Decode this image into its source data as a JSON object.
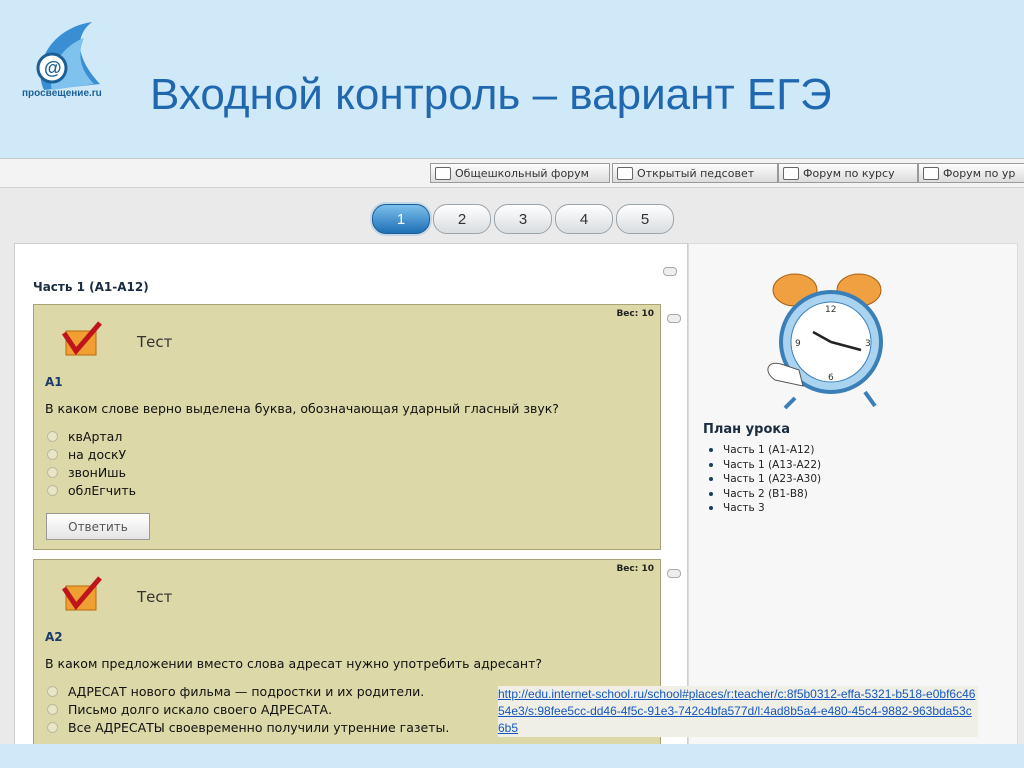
{
  "slide": {
    "title": "Входной контроль – вариант ЕГЭ",
    "logo_text": "просвещение.ru"
  },
  "forums": [
    {
      "label": "Общешкольный форум"
    },
    {
      "label": "Открытый педсовет"
    },
    {
      "label": "Форум по курсу"
    },
    {
      "label": "Форум по ур"
    }
  ],
  "pager": {
    "pages": [
      "1",
      "2",
      "3",
      "4",
      "5"
    ],
    "current": "1"
  },
  "main": {
    "part_heading": "Часть 1 (А1-А12)",
    "questions": [
      {
        "weight": "Вес: 10",
        "label": "Тест",
        "number": "А1",
        "text": "В каком слове верно выделена буква, обозначающая ударный гласный звук?",
        "options": [
          "квАртал",
          "на доскУ",
          "звонИшь",
          "облЕгчить"
        ],
        "submit": "Ответить"
      },
      {
        "weight": "Вес: 10",
        "label": "Тест",
        "number": "А2",
        "text": "В каком предложении вместо слова адресат нужно употребить адресант?",
        "options": [
          "АДРЕСАТ нового фильма — подростки и их родители.",
          "Письмо долго искало своего АДРЕСАТА.",
          "Все АДРЕСАТЫ своевременно получили утренние газеты."
        ]
      }
    ]
  },
  "sidebar": {
    "plan_title": "План урока",
    "items": [
      "Часть 1 (А1-А12)",
      "Часть 1 (А13-А22)",
      "Часть 1 (А23-А30)",
      "Часть 2 (В1-В8)",
      "Часть 3"
    ]
  },
  "link": {
    "url": "http://edu.internet-school.ru/school#places/r:teacher/c:8f5b0312-effa-5321-b518-e0bf6c4654e3/s:98fee5cc-dd46-4f5c-91e3-742c4bfa577d/l:4ad8b5a4-e480-45c4-9882-963bda53c6b5"
  },
  "colors": {
    "title": "#1f67ae",
    "question_bg": "#dcd8a8",
    "active_page": "#1e6fb5",
    "link": "#1656c0"
  }
}
